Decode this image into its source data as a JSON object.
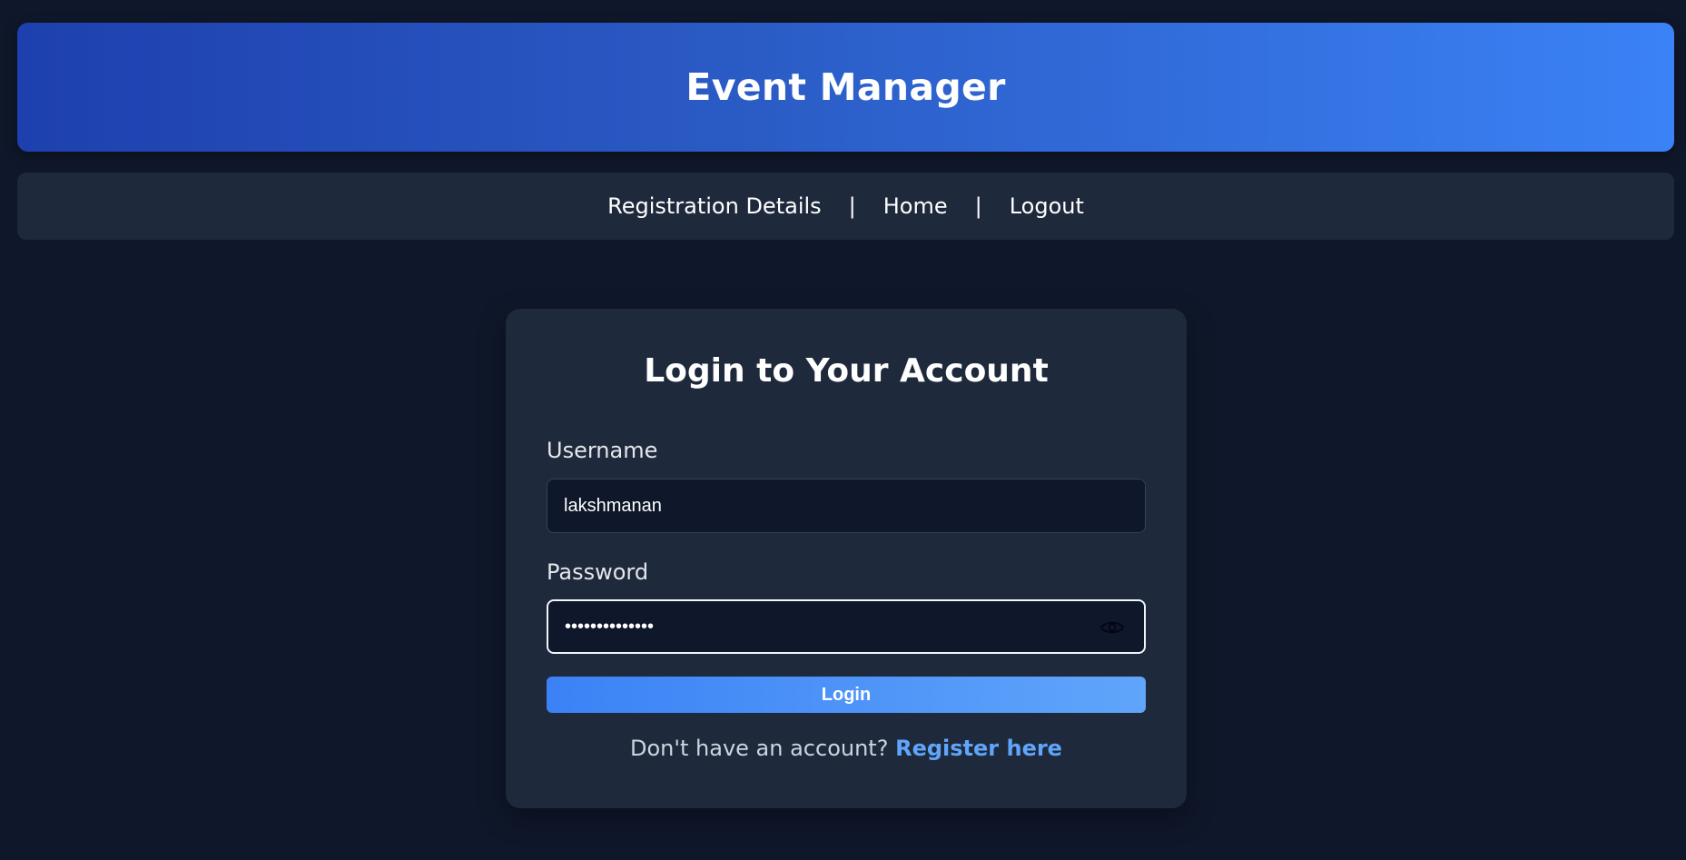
{
  "header": {
    "title": "Event Manager"
  },
  "nav": {
    "items": [
      {
        "label": "Registration Details"
      },
      {
        "label": "Home"
      },
      {
        "label": "Logout"
      }
    ],
    "separator": "|"
  },
  "login": {
    "title": "Login to Your Account",
    "username_label": "Username",
    "username_value": "lakshmanan",
    "password_label": "Password",
    "password_value": "lakshmanan1234",
    "show_password_icon": "eye-icon",
    "button_label": "Login",
    "register_prompt": "Don't have an account?",
    "register_link": "Register here"
  },
  "colors": {
    "background": "#0f172a",
    "card": "#1e293b",
    "header_gradient_start": "#1e40af",
    "header_gradient_end": "#3b82f6",
    "accent": "#60a5fa"
  }
}
